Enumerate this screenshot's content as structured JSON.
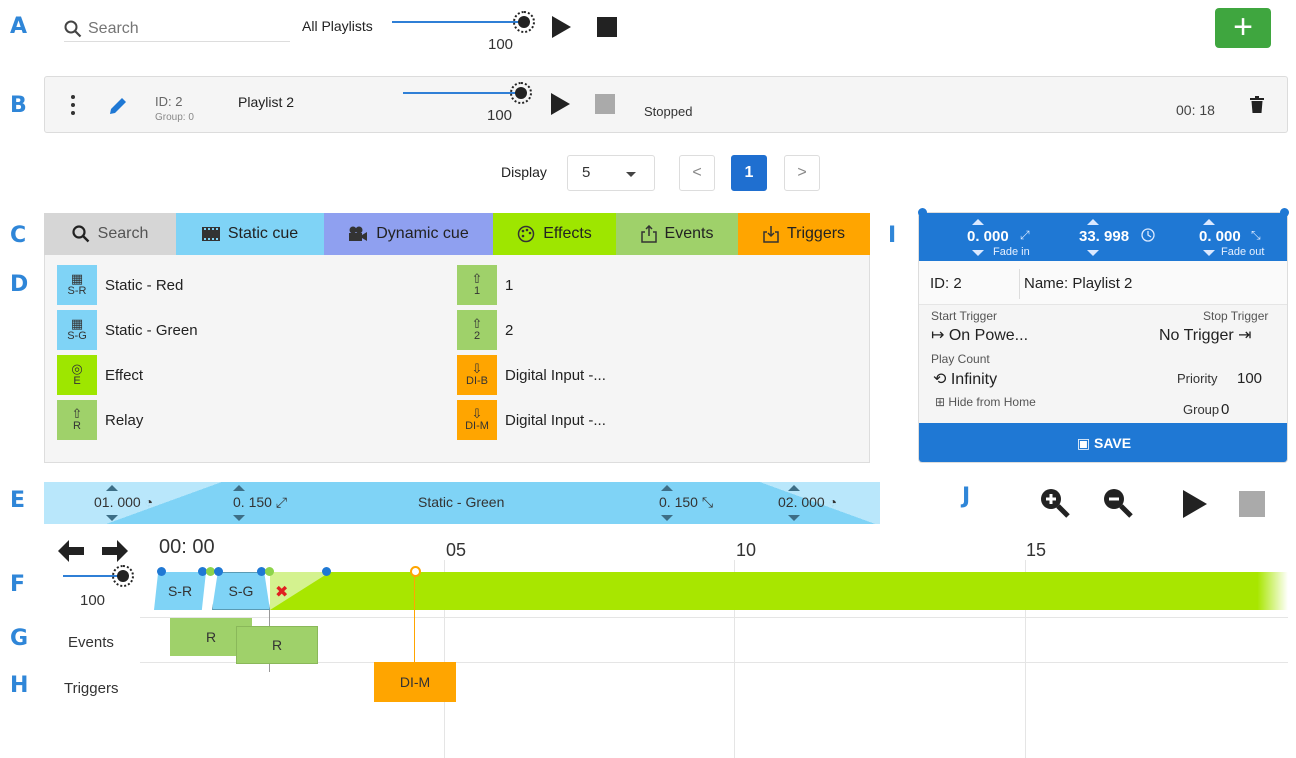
{
  "section_letters": [
    "A",
    "B",
    "C",
    "D",
    "E",
    "F",
    "G",
    "H",
    "I",
    "J"
  ],
  "top": {
    "search_placeholder": "Search",
    "all_playlists_label": "All Playlists",
    "master_volume": "100",
    "master_volume_level": 1.0,
    "add_button": "+"
  },
  "playlist_row": {
    "id_label": "ID:",
    "id_value": "2",
    "group_label": "Group:",
    "group_value": "0",
    "name": "Playlist 2",
    "volume": "100",
    "status": "Stopped",
    "duration": "00: 18"
  },
  "pagination": {
    "display_label": "Display",
    "page_size": "5",
    "prev": "<",
    "current_page": "1",
    "next": ">"
  },
  "tabs": [
    {
      "label": "Search",
      "color": "#d6d6d6",
      "icon": "search-icon"
    },
    {
      "label": "Static cue",
      "color": "#7fd3f6",
      "icon": "film-strip-icon"
    },
    {
      "label": "Dynamic cue",
      "color": "#8fa0f0",
      "icon": "movie-camera-icon"
    },
    {
      "label": "Effects",
      "color": "#9ee600",
      "icon": "palette-icon"
    },
    {
      "label": "Events",
      "color": "#9fd16a",
      "icon": "share-out-icon"
    },
    {
      "label": "Triggers",
      "color": "#ffa500",
      "icon": "import-in-icon"
    }
  ],
  "library": {
    "left": [
      {
        "badge": "S-R",
        "label": "Static - Red",
        "color": "#7fd3f6",
        "icon": "film-strip-icon"
      },
      {
        "badge": "S-G",
        "label": "Static - Green",
        "color": "#7fd3f6",
        "icon": "film-strip-icon"
      },
      {
        "badge": "E",
        "label": "Effect",
        "color": "#9ee600",
        "icon": "palette-icon"
      },
      {
        "badge": "R",
        "label": "Relay",
        "color": "#9fd16a",
        "icon": "share-out-icon"
      }
    ],
    "right": [
      {
        "badge": "1",
        "label": "1",
        "color": "#9fd16a",
        "icon": "share-out-icon"
      },
      {
        "badge": "2",
        "label": "2",
        "color": "#9fd16a",
        "icon": "share-out-icon"
      },
      {
        "badge": "DI-B",
        "label": "Digital Input -...",
        "color": "#ffa500",
        "icon": "import-in-icon"
      },
      {
        "badge": "DI-M",
        "label": "Digital Input -...",
        "color": "#ffa500",
        "icon": "import-in-icon"
      }
    ]
  },
  "panel": {
    "fade_in_value": "0. 000",
    "fade_in_label": "Fade in",
    "duration_value": "33. 998",
    "fade_out_value": "0. 000",
    "fade_out_label": "Fade out",
    "id_label": "ID:",
    "id_value": "2",
    "name_label": "Name:",
    "name_value": "Playlist 2",
    "start_trigger_label": "Start Trigger",
    "start_trigger_value": "On Powe...",
    "stop_trigger_label": "Stop Trigger",
    "stop_trigger_value": "No Trigger",
    "play_count_label": "Play Count",
    "play_count_value": "Infinity",
    "priority_label": "Priority",
    "priority_value": "100",
    "hide_label": "Hide from Home",
    "group_label": "Group",
    "group_value": "0",
    "save_label": "SAVE"
  },
  "cue_bar": {
    "delay_in": "01. 000",
    "fade_in": "0. 150",
    "name": "Static - Green",
    "fade_out": "0. 150",
    "delay_out": "02. 000"
  },
  "timeline": {
    "ticks": [
      "00: 00",
      "05",
      "10",
      "15"
    ],
    "volume": "100",
    "volume_level": 1.0,
    "cue_blocks": [
      "S-R",
      "S-G"
    ],
    "events_label": "Events",
    "event_blocks": [
      "R",
      "R"
    ],
    "triggers_label": "Triggers",
    "trigger_blocks": [
      "DI-M"
    ]
  },
  "colors": {
    "accent_blue": "#1f78d4",
    "add_green": "#3fa63f",
    "cue_blue": "#7fd3f6",
    "effect_green": "#a8e600",
    "event_green": "#9fd16a",
    "trigger_orange": "#ffa500"
  }
}
